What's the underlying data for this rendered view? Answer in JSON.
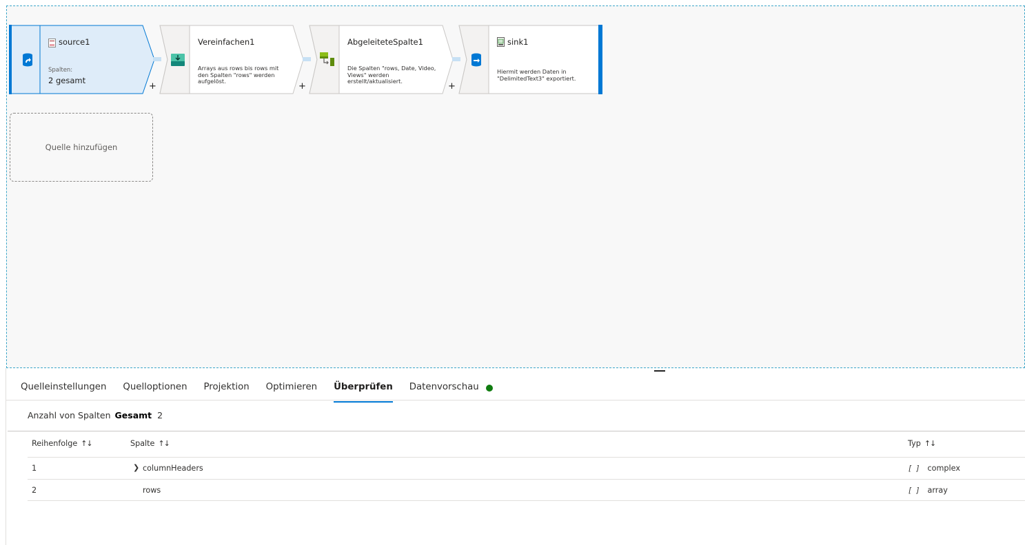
{
  "flow": {
    "nodes": [
      {
        "id": "source1",
        "title": "source1",
        "meta_label": "Spalten:",
        "meta_value": "2 gesamt",
        "icon": "source-icon",
        "title_icon": "json-file-icon"
      },
      {
        "id": "flatten",
        "title": "Vereinfachen1",
        "description": "Arrays aus rows bis rows mit den Spalten \"rows\" werden aufgelöst.",
        "icon": "flatten-icon"
      },
      {
        "id": "derived",
        "title": "AbgeleiteteSpalte1",
        "description": "Die Spalten \"rows, Date, Video, Views\" werden erstellt/aktualisiert.",
        "icon": "derived-column-icon"
      },
      {
        "id": "sink1",
        "title": "sink1",
        "description": "Hiermit werden Daten in \"DelimitedText3\" exportiert.",
        "icon": "sink-icon",
        "title_icon": "csv-file-icon"
      }
    ],
    "plus_symbol": "+",
    "add_source_label": "Quelle hinzufügen",
    "colors": {
      "accent": "#0078d4",
      "selected_fill": "#deecf9",
      "connector": "#c7e0f4"
    }
  },
  "tabs": [
    {
      "label": "Quelleinstellungen",
      "active": false
    },
    {
      "label": "Quelloptionen",
      "active": false
    },
    {
      "label": "Projektion",
      "active": false
    },
    {
      "label": "Optimieren",
      "active": false
    },
    {
      "label": "Überprüfen",
      "active": true
    },
    {
      "label": "Datenvorschau",
      "active": false,
      "status": "success-dot"
    }
  ],
  "summary": {
    "label": "Anzahl von Spalten",
    "total_label": "Gesamt",
    "total_value": "2"
  },
  "table": {
    "headers": {
      "order": "Reihenfolge",
      "column": "Spalte",
      "type": "Typ"
    },
    "sort_icon": "↑↓",
    "rows": [
      {
        "order": "1",
        "column": "columnHeaders",
        "type_icon": "[ ]",
        "type": "complex",
        "expandable": true
      },
      {
        "order": "2",
        "column": "rows",
        "type_icon": "[ ]",
        "type": "array",
        "expandable": false
      }
    ]
  }
}
